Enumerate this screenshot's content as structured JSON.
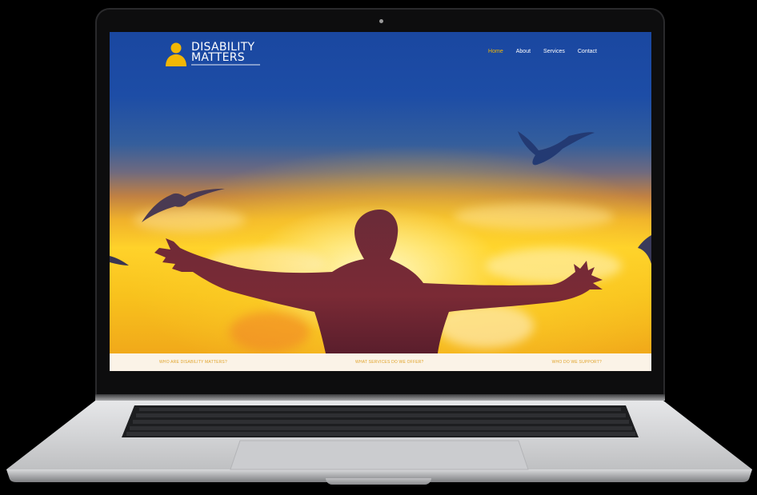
{
  "site": {
    "logo": {
      "line1": "DISABILITY",
      "line2": "MATTERS",
      "icon": "person-icon"
    },
    "nav": [
      "Home",
      "About",
      "Services",
      "Contact"
    ],
    "nav_active": "Home",
    "strip": {
      "left": "WHO ARE DISABILITY MATTERS?",
      "center": "WHAT SERVICES DO WE OFFER?",
      "right": "WHO DO WE SUPPORT?"
    }
  },
  "colors": {
    "header_blue": "#1a47a0",
    "accent_gold": "#f2b705",
    "strip_bg": "#fbf3e7",
    "strip_text": "#e0a32a",
    "bezel": "#0d0d0e",
    "aluminium": "#c8c9cb"
  }
}
